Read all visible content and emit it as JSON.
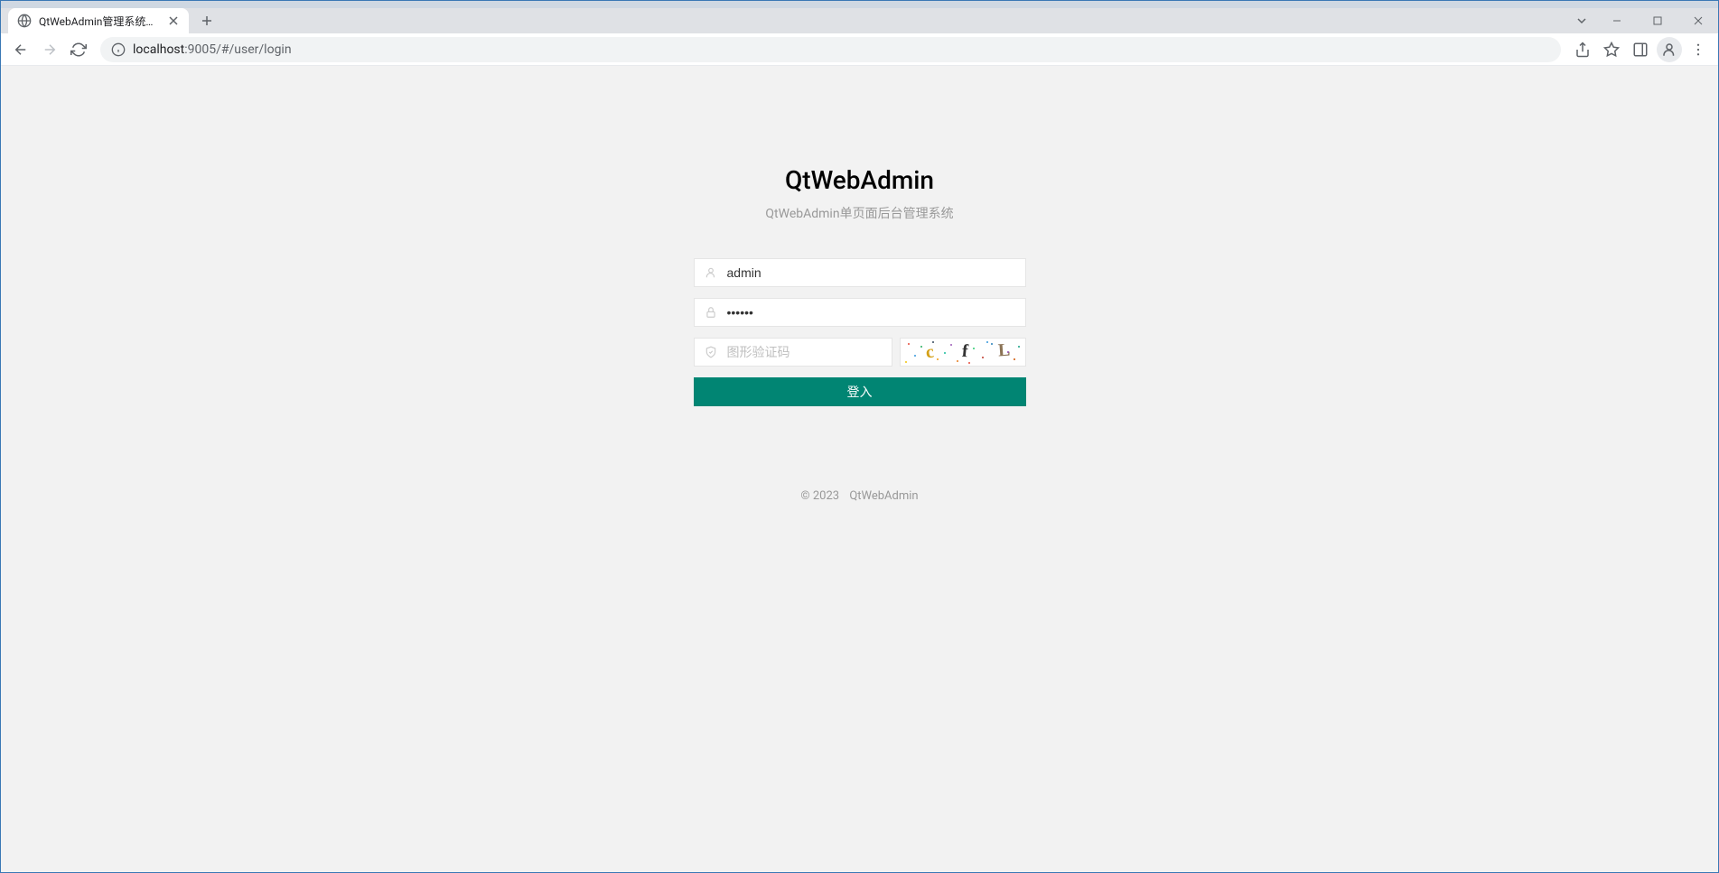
{
  "browser": {
    "tab_title": "QtWebAdmin管理系统（单页面",
    "url_host": "localhost",
    "url_port": ":9005",
    "url_path": "/#/user/login"
  },
  "login": {
    "title": "QtWebAdmin",
    "subtitle": "QtWebAdmin单页面后台管理系统",
    "username_value": "admin",
    "password_value": "••••••",
    "captcha_placeholder": "图形验证码",
    "captcha_text": "c f L",
    "login_button": "登入"
  },
  "footer": {
    "copyright": "© 2023",
    "product": "QtWebAdmin"
  }
}
